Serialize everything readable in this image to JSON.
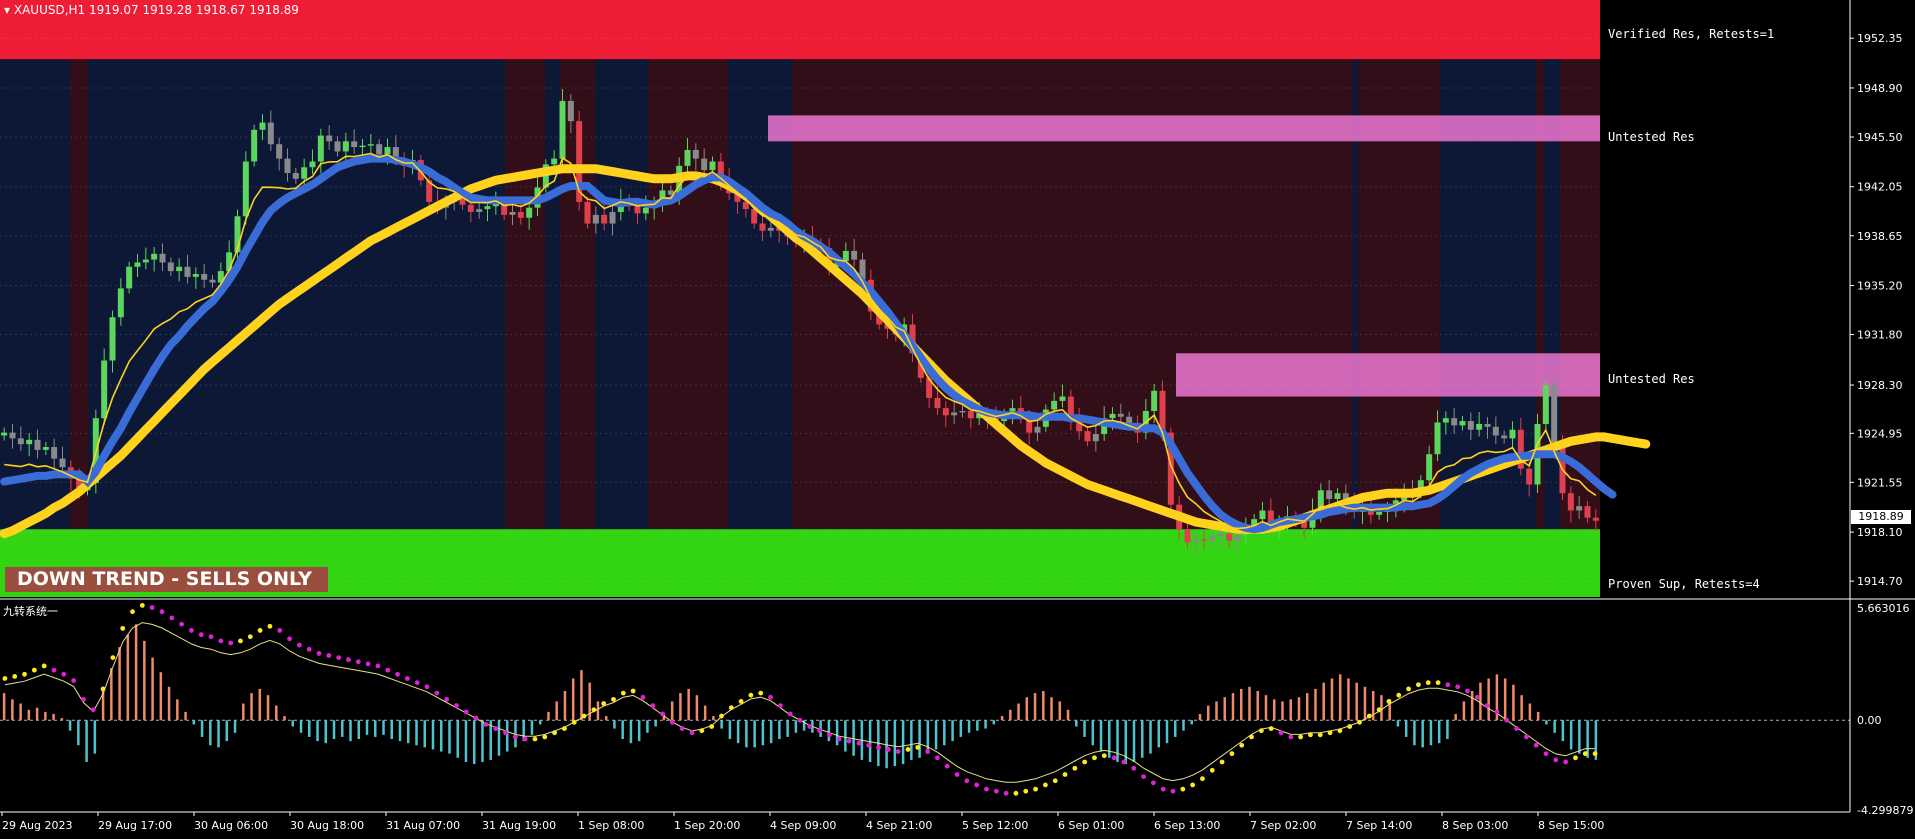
{
  "header": {
    "symbol_line": "XAUUSD,H1  1919.07 1919.28 1918.67 1918.89"
  },
  "banner": {
    "text": "DOWN TREND - SELLS ONLY"
  },
  "indicator": {
    "title": "九转系统一"
  },
  "colors": {
    "background": "#000000",
    "bull_candle": "#5cd65c",
    "bear_candle": "#e0404c",
    "neutral_candle": "#8a8a8a",
    "resistance_verified": "#ee1c34",
    "resistance_untested": "#e070c8",
    "support_proven": "#33d412",
    "ma_fast": "#3a6cd8",
    "ma_slow": "#ffd21e",
    "bg_bull": "#0c1836",
    "bg_bear": "#320e18"
  },
  "zones": {
    "verified_res": {
      "label": "Verified Res, Retests=1",
      "low": 1950.9,
      "high": 1955.0
    },
    "untested_res_1": {
      "label": "Untested Res",
      "low": 1945.2,
      "high": 1947.0
    },
    "untested_res_2": {
      "label": "Untested Res",
      "low": 1927.5,
      "high": 1930.5
    },
    "proven_sup": {
      "label": "Proven Sup, Retests=4",
      "low": 1913.6,
      "high": 1918.3
    }
  },
  "chart_data": [
    {
      "type": "candlestick",
      "symbol": "XAUUSD",
      "timeframe": "H1",
      "ohlc_current": {
        "open": 1919.07,
        "high": 1919.28,
        "low": 1918.67,
        "close": 1918.89
      },
      "current_price": "1918.89",
      "ylim": [
        1913.6,
        1955.0
      ],
      "y_ticks": [
        "1952.35",
        "1948.90",
        "1945.50",
        "1942.05",
        "1938.65",
        "1935.20",
        "1931.80",
        "1928.30",
        "1924.95",
        "1921.55",
        "1918.10",
        "1914.70"
      ],
      "x_ticks": [
        "29 Aug 2023",
        "29 Aug 17:00",
        "30 Aug 06:00",
        "30 Aug 18:00",
        "31 Aug 07:00",
        "31 Aug 19:00",
        "1 Sep 08:00",
        "1 Sep 20:00",
        "4 Sep 09:00",
        "4 Sep 21:00",
        "5 Sep 12:00",
        "6 Sep 01:00",
        "6 Sep 13:00",
        "7 Sep 02:00",
        "7 Sep 14:00",
        "8 Sep 03:00",
        "8 Sep 15:00"
      ],
      "close_series": [
        1925.0,
        1924.6,
        1924.2,
        1924.5,
        1923.8,
        1924.0,
        1923.2,
        1922.6,
        1921.8,
        1921.0,
        1921.5,
        1926.0,
        1930.0,
        1933.0,
        1935.0,
        1936.5,
        1936.8,
        1937.0,
        1937.4,
        1936.8,
        1936.2,
        1936.5,
        1935.8,
        1936.0,
        1935.6,
        1935.4,
        1936.2,
        1937.5,
        1940.0,
        1943.8,
        1946.0,
        1946.5,
        1945.0,
        1944.0,
        1943.0,
        1942.6,
        1943.4,
        1943.8,
        1945.6,
        1945.2,
        1944.5,
        1945.2,
        1944.8,
        1944.9,
        1945.0,
        1944.3,
        1944.8,
        1944.0,
        1943.5,
        1943.9,
        1942.5,
        1941.0,
        1940.6,
        1941.0,
        1941.2,
        1940.8,
        1940.3,
        1940.5,
        1940.7,
        1941.0,
        1940.1,
        1940.3,
        1939.9,
        1940.6,
        1942.0,
        1943.6,
        1944.0,
        1948.0,
        1946.6,
        1941.0,
        1939.5,
        1940.1,
        1939.5,
        1940.3,
        1941.2,
        1940.7,
        1940.2,
        1940.6,
        1940.9,
        1941.8,
        1941.5,
        1943.5,
        1944.6,
        1944.0,
        1943.2,
        1943.8,
        1942.5,
        1941.6,
        1941.0,
        1940.5,
        1939.5,
        1939.0,
        1939.2,
        1939.0,
        1938.6,
        1938.2,
        1938.5,
        1938.0,
        1937.8,
        1936.5,
        1936.9,
        1937.6,
        1937.0,
        1935.6,
        1933.4,
        1932.5,
        1932.2,
        1931.8,
        1932.5,
        1930.5,
        1928.8,
        1927.4,
        1926.7,
        1926.2,
        1926.4,
        1926.5,
        1926.0,
        1926.3,
        1926.1,
        1925.8,
        1926.3,
        1926.7,
        1926.1,
        1925.0,
        1925.4,
        1926.6,
        1927.2,
        1927.5,
        1926.0,
        1925.1,
        1924.4,
        1924.9,
        1926.0,
        1926.3,
        1926.1,
        1925.6,
        1925.0,
        1926.5,
        1927.9,
        1925.0,
        1920.0,
        1918.3,
        1917.4,
        1917.6,
        1917.5,
        1917.8,
        1918.0,
        1917.5,
        1917.9,
        1918.4,
        1919.0,
        1919.6,
        1918.5,
        1918.8,
        1919.2,
        1918.8,
        1918.4,
        1919.6,
        1921.0,
        1920.4,
        1920.8,
        1920.0,
        1919.5,
        1919.8,
        1919.3,
        1919.5,
        1919.6,
        1920.3,
        1921.0,
        1920.8,
        1921.7,
        1923.5,
        1925.7,
        1926.0,
        1925.5,
        1925.8,
        1925.2,
        1925.6,
        1925.4,
        1924.8,
        1924.6,
        1925.2,
        1922.5,
        1921.4,
        1925.6,
        1928.3,
        1924.0,
        1920.8,
        1919.6,
        1919.9,
        1919.1,
        1918.89
      ],
      "series": [
        {
          "name": "MA fast",
          "color": "#3a6cd8",
          "values": [
            1921.6,
            1921.7,
            1921.8,
            1921.9,
            1922.0,
            1922.0,
            1922.1,
            1922.1,
            1922.1,
            1922.1,
            1921.6,
            1922.3,
            1923.4,
            1924.4,
            1925.3,
            1926.4,
            1927.4,
            1928.4,
            1929.4,
            1930.3,
            1931.1,
            1931.7,
            1932.4,
            1933.0,
            1933.6,
            1934.1,
            1934.8,
            1935.6,
            1936.5,
            1937.6,
            1938.6,
            1939.6,
            1940.4,
            1940.9,
            1941.3,
            1941.6,
            1941.9,
            1942.2,
            1942.6,
            1943.0,
            1943.4,
            1943.6,
            1943.8,
            1943.9,
            1944.0,
            1944.0,
            1944.0,
            1943.9,
            1943.8,
            1943.6,
            1943.4,
            1943.1,
            1942.7,
            1942.4,
            1942.0,
            1941.6,
            1941.3,
            1941.2,
            1941.1,
            1941.1,
            1941.1,
            1941.1,
            1941.1,
            1941.1,
            1941.1,
            1941.3,
            1941.6,
            1941.9,
            1942.1,
            1942.1,
            1942.1,
            1941.6,
            1941.1,
            1941.0,
            1940.9,
            1941.0,
            1941.0,
            1940.9,
            1940.8,
            1941.0,
            1941.1,
            1941.4,
            1941.8,
            1942.2,
            1942.5,
            1942.7,
            1942.7,
            1942.4,
            1942.0,
            1941.6,
            1941.1,
            1940.6,
            1940.2,
            1939.9,
            1939.5,
            1939.0,
            1938.6,
            1938.3,
            1937.9,
            1937.5,
            1937.0,
            1936.5,
            1936.0,
            1935.4,
            1934.8,
            1934.1,
            1933.4,
            1932.6,
            1931.8,
            1931.0,
            1930.2,
            1929.4,
            1928.7,
            1928.1,
            1927.6,
            1927.2,
            1926.9,
            1926.6,
            1926.4,
            1926.3,
            1926.2,
            1926.2,
            1926.2,
            1926.2,
            1926.1,
            1926.1,
            1926.1,
            1926.1,
            1926.0,
            1926.0,
            1925.9,
            1925.8,
            1925.7,
            1925.6,
            1925.5,
            1925.4,
            1925.4,
            1925.3,
            1925.3,
            1925.0,
            1924.2,
            1923.2,
            1922.2,
            1921.4,
            1920.6,
            1919.9,
            1919.3,
            1918.9,
            1918.6,
            1918.4,
            1918.3,
            1918.4,
            1918.6,
            1918.8,
            1918.9,
            1919.0,
            1919.1,
            1919.2,
            1919.3,
            1919.5,
            1919.6,
            1919.7,
            1919.8,
            1919.8,
            1919.8,
            1919.8,
            1919.8,
            1919.8,
            1919.9,
            1919.9,
            1920.0,
            1920.1,
            1920.4,
            1920.8,
            1921.3,
            1921.8,
            1922.2,
            1922.5,
            1922.8,
            1923.0,
            1923.2,
            1923.3,
            1923.4,
            1923.4,
            1923.5,
            1923.5,
            1923.5,
            1923.3,
            1923.0,
            1922.6,
            1922.1,
            1921.6,
            1921.1,
            1920.7
          ]
        },
        {
          "name": "MA slow",
          "color": "#ffd21e",
          "values": [
            1918.0,
            1918.2,
            1918.5,
            1918.8,
            1919.1,
            1919.4,
            1919.8,
            1920.1,
            1920.5,
            1920.9,
            1921.4,
            1921.9,
            1922.4,
            1922.9,
            1923.4,
            1924.0,
            1924.6,
            1925.2,
            1925.8,
            1926.4,
            1927.0,
            1927.6,
            1928.2,
            1928.8,
            1929.4,
            1929.9,
            1930.4,
            1930.9,
            1931.4,
            1931.9,
            1932.4,
            1932.9,
            1933.4,
            1933.9,
            1934.3,
            1934.7,
            1935.1,
            1935.5,
            1935.9,
            1936.3,
            1936.7,
            1937.1,
            1937.5,
            1937.9,
            1938.3,
            1938.6,
            1938.9,
            1939.2,
            1939.5,
            1939.8,
            1940.1,
            1940.4,
            1940.7,
            1941.0,
            1941.3,
            1941.6,
            1941.9,
            1942.1,
            1942.3,
            1942.5,
            1942.6,
            1942.7,
            1942.8,
            1942.9,
            1943.0,
            1943.1,
            1943.2,
            1943.3,
            1943.3,
            1943.3,
            1943.3,
            1943.3,
            1943.2,
            1943.1,
            1943.0,
            1942.9,
            1942.8,
            1942.7,
            1942.6,
            1942.6,
            1942.6,
            1942.7,
            1942.8,
            1942.8,
            1942.7,
            1942.6,
            1942.4,
            1942.1,
            1941.8,
            1941.4,
            1941.0,
            1940.5,
            1940.0,
            1939.5,
            1939.0,
            1938.5,
            1938.1,
            1937.6,
            1937.1,
            1936.6,
            1936.1,
            1935.6,
            1935.1,
            1934.6,
            1934.0,
            1933.4,
            1932.8,
            1932.2,
            1931.6,
            1931.0,
            1930.4,
            1929.8,
            1929.2,
            1928.6,
            1928.1,
            1927.6,
            1927.1,
            1926.6,
            1926.1,
            1925.6,
            1925.1,
            1924.6,
            1924.1,
            1923.7,
            1923.3,
            1922.9,
            1922.6,
            1922.3,
            1922.0,
            1921.7,
            1921.4,
            1921.2,
            1921.0,
            1920.8,
            1920.6,
            1920.4,
            1920.2,
            1920.0,
            1919.8,
            1919.6,
            1919.4,
            1919.2,
            1919.0,
            1918.8,
            1918.7,
            1918.6,
            1918.5,
            1918.4,
            1918.3,
            1918.3,
            1918.3,
            1918.3,
            1918.4,
            1918.5,
            1918.7,
            1918.9,
            1919.1,
            1919.3,
            1919.5,
            1919.7,
            1919.9,
            1920.1,
            1920.3,
            1920.5,
            1920.6,
            1920.7,
            1920.8,
            1920.8,
            1920.8,
            1920.8,
            1920.9,
            1921.0,
            1921.2,
            1921.4,
            1921.6,
            1921.8,
            1922.0,
            1922.2,
            1922.4,
            1922.6,
            1922.8,
            1923.0,
            1923.2,
            1923.4,
            1923.6,
            1923.8,
            1924.0,
            1924.2,
            1924.4,
            1924.5,
            1924.6,
            1924.7,
            1924.7,
            1924.6,
            1924.5,
            1924.4,
            1924.3,
            1924.2
          ]
        }
      ]
    },
    {
      "type": "bar",
      "title": "九转系统一",
      "ylim": [
        -4.299879,
        5.663016
      ],
      "y_ticks": [
        "5.663016",
        "0.00",
        "-4.299879"
      ],
      "histogram": [
        1.3,
        1.0,
        0.8,
        0.5,
        0.6,
        0.4,
        0.3,
        0.1,
        -0.5,
        -1.2,
        -2.0,
        -1.6,
        1.5,
        2.5,
        3.5,
        4.1,
        4.6,
        3.8,
        3.0,
        2.3,
        1.6,
        1.0,
        0.4,
        -0.2,
        -0.8,
        -1.2,
        -1.3,
        -1.0,
        -0.6,
        0.8,
        1.3,
        1.5,
        1.2,
        0.7,
        0.2,
        -0.3,
        -0.6,
        -0.8,
        -1.0,
        -1.1,
        -0.9,
        -0.8,
        -1.0,
        -0.9,
        -0.7,
        -0.8,
        -0.7,
        -0.9,
        -1.0,
        -1.1,
        -1.2,
        -1.3,
        -1.4,
        -1.5,
        -1.6,
        -1.8,
        -2.0,
        -2.1,
        -2.0,
        -1.9,
        -1.7,
        -1.5,
        -1.3,
        -1.0,
        -0.7,
        -0.2,
        0.4,
        0.9,
        1.4,
        2.0,
        2.4,
        1.8,
        0.9,
        0.2,
        -0.4,
        -0.9,
        -1.1,
        -1.0,
        -0.6,
        -0.3,
        0.3,
        0.9,
        1.3,
        1.5,
        1.2,
        0.7,
        0.2,
        -0.4,
        -0.9,
        -1.1,
        -1.3,
        -1.3,
        -1.2,
        -1.1,
        -0.9,
        -0.8,
        -0.6,
        -0.5,
        -0.6,
        -0.8,
        -1.0,
        -1.2,
        -1.5,
        -1.7,
        -1.9,
        -2.0,
        -2.2,
        -2.3,
        -2.2,
        -2.1,
        -1.9,
        -1.8,
        -1.6,
        -1.4,
        -1.2,
        -1.0,
        -0.8,
        -0.6,
        -0.5,
        -0.4,
        -0.2,
        0.2,
        0.5,
        0.8,
        1.1,
        1.3,
        1.4,
        1.1,
        0.9,
        0.5,
        -0.3,
        -0.8,
        -1.2,
        -1.5,
        -1.8,
        -2.0,
        -2.1,
        -2.0,
        -1.8,
        -1.6,
        -1.3,
        -1.1,
        -0.8,
        -0.5,
        -0.2,
        0.3,
        0.7,
        0.9,
        1.1,
        1.3,
        1.5,
        1.6,
        1.4,
        1.2,
        1.0,
        0.9,
        1.0,
        1.1,
        1.3,
        1.5,
        1.8,
        2.0,
        2.2,
        2.0,
        1.8,
        1.6,
        1.4,
        1.2,
        1.0,
        -0.3,
        -0.8,
        -1.2,
        -1.3,
        -1.2,
        -1.1,
        -0.9,
        0.3,
        0.9,
        1.4,
        1.8,
        2.0,
        2.2,
        2.0,
        1.7,
        1.2,
        0.8,
        0.4,
        -0.2,
        -0.6,
        -1.0,
        -1.4,
        -1.6,
        -1.8,
        -1.9
      ],
      "signal_dotted": [
        2.0,
        2.1,
        2.2,
        2.4,
        2.6,
        2.4,
        2.2,
        1.9,
        1.0,
        0.5,
        1.5,
        3.0,
        4.4,
        5.2,
        5.5,
        5.4,
        5.2,
        4.9,
        4.6,
        4.3,
        4.1,
        4.0,
        3.8,
        3.7,
        3.8,
        4.0,
        4.3,
        4.5,
        4.3,
        3.9,
        3.6,
        3.4,
        3.2,
        3.1,
        3.0,
        2.9,
        2.8,
        2.7,
        2.6,
        2.4,
        2.2,
        2.0,
        1.8,
        1.6,
        1.3,
        1.0,
        0.7,
        0.4,
        0.1,
        -0.2,
        -0.4,
        -0.6,
        -0.8,
        -0.9,
        -0.9,
        -0.8,
        -0.6,
        -0.4,
        -0.1,
        0.2,
        0.5,
        0.8,
        1.0,
        1.3,
        1.4,
        1.1,
        0.7,
        0.3,
        -0.1,
        -0.4,
        -0.6,
        -0.5,
        -0.3,
        0.2,
        0.6,
        0.9,
        1.2,
        1.3,
        1.1,
        0.7,
        0.3,
        0.0,
        -0.3,
        -0.5,
        -0.7,
        -0.9,
        -1.0,
        -1.1,
        -1.2,
        -1.3,
        -1.4,
        -1.5,
        -1.4,
        -1.3,
        -1.5,
        -1.8,
        -2.2,
        -2.6,
        -2.9,
        -3.1,
        -3.3,
        -3.4,
        -3.5,
        -3.5,
        -3.4,
        -3.3,
        -3.1,
        -2.9,
        -2.6,
        -2.3,
        -2.0,
        -1.8,
        -1.7,
        -1.8,
        -2.0,
        -2.3,
        -2.7,
        -3.0,
        -3.3,
        -3.4,
        -3.3,
        -3.1,
        -2.8,
        -2.4,
        -2.0,
        -1.6,
        -1.2,
        -0.8,
        -0.5,
        -0.4,
        -0.6,
        -0.8,
        -0.8,
        -0.7,
        -0.7,
        -0.6,
        -0.5,
        -0.3,
        -0.1,
        0.2,
        0.5,
        0.9,
        1.2,
        1.5,
        1.7,
        1.8,
        1.8,
        1.7,
        1.6,
        1.4,
        1.1,
        0.7,
        0.4,
        0.0,
        -0.4,
        -0.8,
        -1.2,
        -1.6,
        -1.9,
        -2.0,
        -1.8,
        -1.6,
        -1.6
      ]
    }
  ]
}
